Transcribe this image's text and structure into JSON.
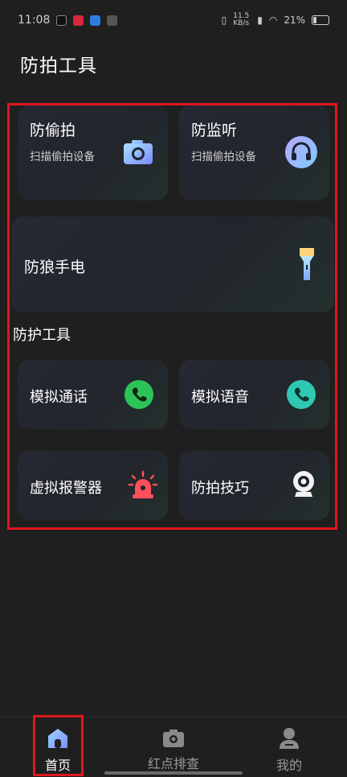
{
  "status_bar": {
    "time": "11:08",
    "net_speed": "11.5 KB/s",
    "battery": "21%"
  },
  "page_title": "防拍工具",
  "cards": {
    "anti_peek": {
      "title": "防偷拍",
      "subtitle": "扫描偷拍设备",
      "icon": "camera-icon"
    },
    "anti_listen": {
      "title": "防监听",
      "subtitle": "扫描偷拍设备",
      "icon": "headphones-icon"
    },
    "flashlight": {
      "title": "防狼手电",
      "icon": "flashlight-icon"
    }
  },
  "section": {
    "title": "防护工具"
  },
  "tools": {
    "fake_call": {
      "title": "模拟通话",
      "icon": "phone-icon"
    },
    "fake_voice": {
      "title": "模拟语音",
      "icon": "phone-icon"
    },
    "alarm": {
      "title": "虚拟报警器",
      "icon": "siren-icon"
    },
    "tips": {
      "title": "防拍技巧",
      "icon": "webcam-icon"
    }
  },
  "bottom_nav": {
    "home": "首页",
    "red_dot_check": "红点排查",
    "mine": "我的"
  },
  "colors": {
    "background": "#1f1f1f",
    "highlight": "#e0161d",
    "green": "#2cc45a",
    "teal": "#2ec9b0",
    "alarm_red": "#ff4f5a",
    "nav_active": "#8fb4ff"
  }
}
